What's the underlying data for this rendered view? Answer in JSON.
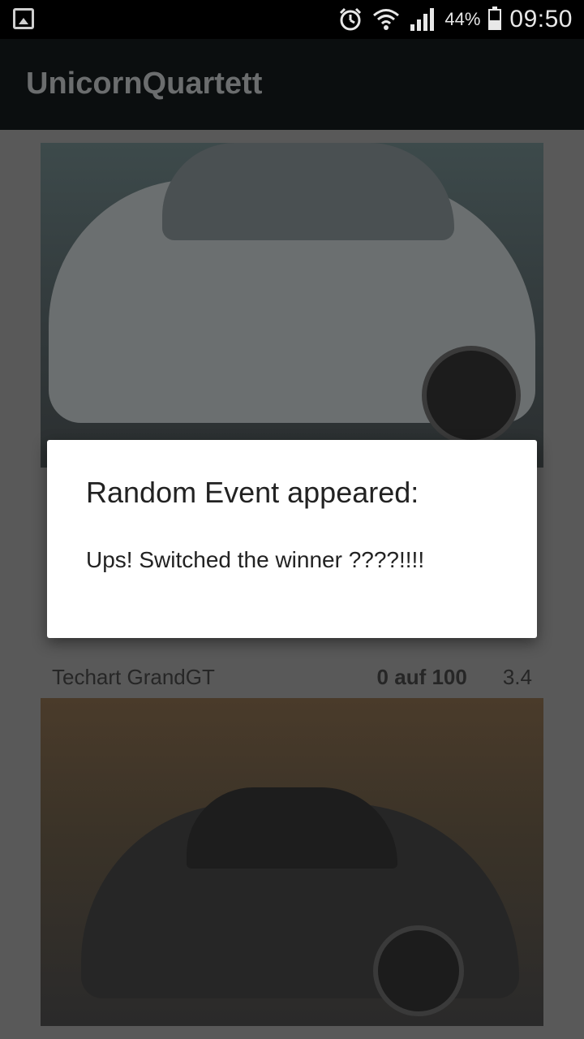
{
  "status_bar": {
    "battery_percent": "44%",
    "time": "09:50",
    "icons": [
      "gallery-icon",
      "alarm-icon",
      "wifi-icon",
      "signal-icon",
      "battery-icon"
    ]
  },
  "app_bar": {
    "title": "UnicornQuartett"
  },
  "cards": [
    {
      "name": "Techart GrandGT",
      "value": "0 auf 100",
      "score": "3.4"
    }
  ],
  "dialog": {
    "title": "Random Event appeared:",
    "message": "Ups! Switched the winner ????!!!!"
  },
  "colors": {
    "dialog_bg": "#ffffff",
    "app_bar_bg": "#0b0e0f",
    "dim_overlay": "#595959"
  }
}
